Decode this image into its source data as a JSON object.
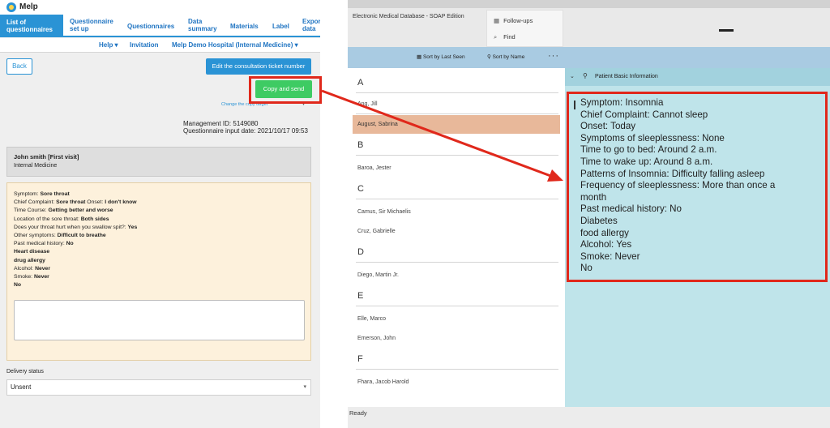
{
  "left": {
    "app_name": "Melp",
    "nav": {
      "items": [
        {
          "label_line1": "List of",
          "label_line2": "questionnaires",
          "active": true
        },
        {
          "label_line1": "Questionnaire",
          "label_line2": "set up"
        },
        {
          "label_line1": "Questionnaires",
          "label_line2": ""
        },
        {
          "label_line1": "Data",
          "label_line2": "summary"
        },
        {
          "label_line1": "Materials",
          "label_line2": ""
        },
        {
          "label_line1": "Label",
          "label_line2": ""
        },
        {
          "label_line1": "Export",
          "label_line2": "data"
        }
      ]
    },
    "subnav": {
      "help": "Help  ▾",
      "invitation": "Invitation",
      "hospital": "Melp Demo Hospital (Internal Medicine)  ▾"
    },
    "buttons": {
      "back": "Back",
      "edit_ticket": "Edit the consultation ticket number",
      "copy_send": "Copy and send",
      "change_copy_target": "Change the copy target"
    },
    "management": {
      "id_line": "Management ID: 5149080",
      "date_line": "Questionnaire input date: 2021/10/17 09:53"
    },
    "patient": {
      "name": "John smith [First visit]",
      "department": "Internal Medicine"
    },
    "answers": {
      "l1_label": "Symptom: ",
      "l1_value": "Sore throat",
      "l2_label": "Chief Complaint: ",
      "l2_value": "Sore throat",
      "l2b_label": " Onset: ",
      "l2b_value": "I don't know",
      "l3_label": "Time Course: ",
      "l3_value": "Getting better and worse",
      "l4_label": "Location of the sore throat: ",
      "l4_value": "Both sides",
      "l5_label": "Does your throat hurt when you swallow spit?: ",
      "l5_value": "Yes",
      "l6_label": "Other symptoms: ",
      "l6_value": "Difficult to breathe",
      "l7_label": "Past medical history: ",
      "l7_value": "No",
      "l8_value": "Heart disease",
      "l9_value": "drug allergy",
      "l10_label": "Alcohol: ",
      "l10_value": "Never",
      "l11_label": "Smoke: ",
      "l11_value": "Never",
      "l12_value": "No"
    },
    "delivery": {
      "label": "Delivery status",
      "value": "Unsent"
    }
  },
  "right": {
    "window_title": "Electronic Medical Database - SOAP Edition",
    "menu": {
      "follow_ups": "Follow-ups",
      "find": "Find"
    },
    "toolbar": {
      "sort_last_seen": "Sort by Last Seen",
      "sort_name": "Sort by Name",
      "more": "···"
    },
    "patients": {
      "letter_a": "A",
      "a1": "Ang, Jill",
      "a2": "August, Sabrina",
      "letter_b": "B",
      "b1": "Baroa, Jester",
      "letter_c": "C",
      "c1": "Camus, Sir Michaelis",
      "c2": "Cruz, Gabrielle",
      "letter_d": "D",
      "d1": "Diego, Martin Jr.",
      "letter_e": "E",
      "e1": "Elle, Marco",
      "e2": "Emerson, John",
      "letter_f": "F",
      "f1": "Fhara, Jacob Harold"
    },
    "detail": {
      "header": "Patient Basic Information",
      "lines": [
        "Symptom: Insomnia",
        "Chief Complaint: Cannot sleep",
        "Onset: Today",
        "Symptoms of sleeplessness: None",
        "Time to go to bed: Around 2 a.m.",
        "Time to wake up: Around 8 a.m.",
        "Patterns of Insomnia: Difficulty falling asleep",
        "Frequency of sleeplessness: More than once a",
        "month",
        "Past medical history: No",
        "Diabetes",
        "food allergy",
        "Alcohol: Yes",
        "Smoke: Never",
        "No"
      ]
    },
    "status": "Ready"
  },
  "annotation": {
    "color": "#e0281b"
  }
}
